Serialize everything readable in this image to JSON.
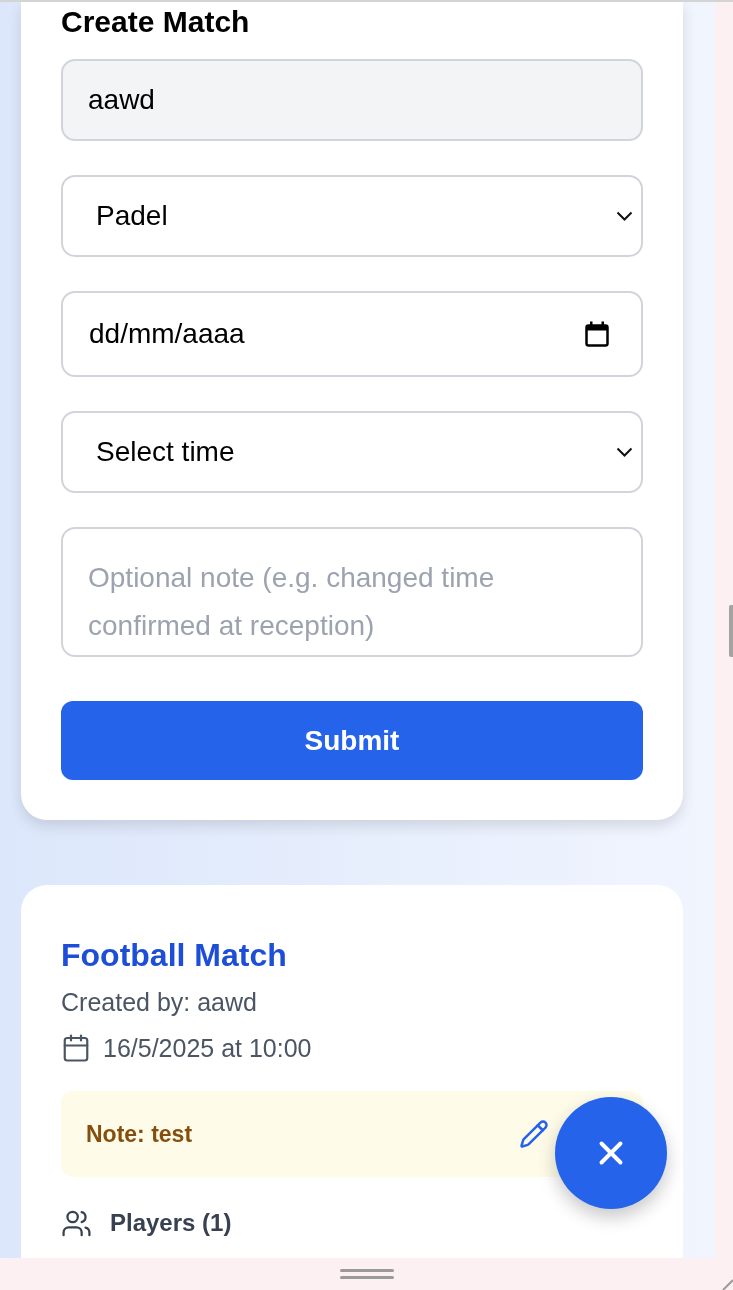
{
  "form": {
    "title": "Create Match",
    "fields": [
      {
        "kind": "text",
        "value": "aawd",
        "disabled": true
      },
      {
        "kind": "select",
        "value": "Padel",
        "disabled": false
      },
      {
        "kind": "date",
        "value": "dd/mm/aaaa",
        "disabled": false
      },
      {
        "kind": "select",
        "value": "Select time",
        "disabled": false
      },
      {
        "kind": "textarea",
        "placeholder": "Optional note (e.g. changed time confirmed at reception)",
        "disabled": false
      }
    ],
    "submit": "Submit"
  },
  "matches": [
    {
      "title": "Football Match",
      "created_by": "Created by: aawd",
      "datetime": "16/5/2025 at 10:00",
      "note": "Note: test",
      "players": "Players (1)"
    }
  ],
  "fab": {
    "open": true
  }
}
